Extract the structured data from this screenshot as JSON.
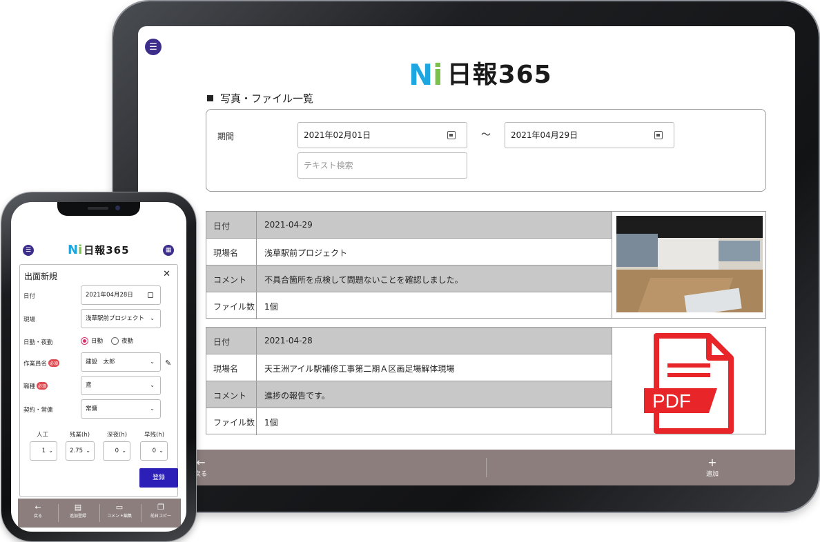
{
  "brand": {
    "logo_mark": "N",
    "logo_mark_i": "i",
    "logo_text": "日報365",
    "accent": "#3d2e8c"
  },
  "tablet": {
    "menu_icon": "hamburger-icon",
    "section_title": "写真・ファイル一覧",
    "filter": {
      "period_label": "期間",
      "date_from": "2021年02月01日",
      "tilde": "～",
      "date_to": "2021年04月29日",
      "search_placeholder": "テキスト検索"
    },
    "records": [
      {
        "date_label": "日付",
        "date": "2021-04-29",
        "site_label": "現場名",
        "site": "浅草駅前プロジェクト",
        "comment_label": "コメント",
        "comment": "不具合箇所を点検して問題ないことを確認しました。",
        "files_label": "ファイル数",
        "files": "1個",
        "thumb": "photo"
      },
      {
        "date_label": "日付",
        "date": "2021-04-28",
        "site_label": "現場名",
        "site": "天王洲アイル駅補修工事第二期Ａ区画足場解体現場",
        "comment_label": "コメント",
        "comment": "進捗の報告です。",
        "files_label": "ファイル数",
        "files": "1個",
        "thumb": "pdf",
        "pdf_text": "PDF"
      }
    ],
    "footer": {
      "back_label": "戻る",
      "add_label": "追加"
    }
  },
  "phone": {
    "form_title": "出面新規",
    "close": "✕",
    "labels": {
      "date": "日付",
      "site": "現場",
      "shift": "日勤・夜勤",
      "worker": "作業員名",
      "job": "職種",
      "contract": "契約・常傭",
      "required": "必須"
    },
    "values": {
      "date": "2021年04月28日",
      "site": "浅草駅前プロジェクト",
      "worker": "建設　太郎",
      "job": "鳶",
      "contract": "常傭"
    },
    "shift_options": [
      "日勤",
      "夜勤"
    ],
    "shift_selected": "日勤",
    "hours": [
      {
        "label": "人工",
        "value": "1"
      },
      {
        "label": "残業(h)",
        "value": "2.75"
      },
      {
        "label": "深夜(h)",
        "value": "0"
      },
      {
        "label": "早残(h)",
        "value": "0"
      }
    ],
    "submit_label": "登録",
    "footer": [
      "戻る",
      "追加登録",
      "コメント編集",
      "前日コピー"
    ]
  }
}
